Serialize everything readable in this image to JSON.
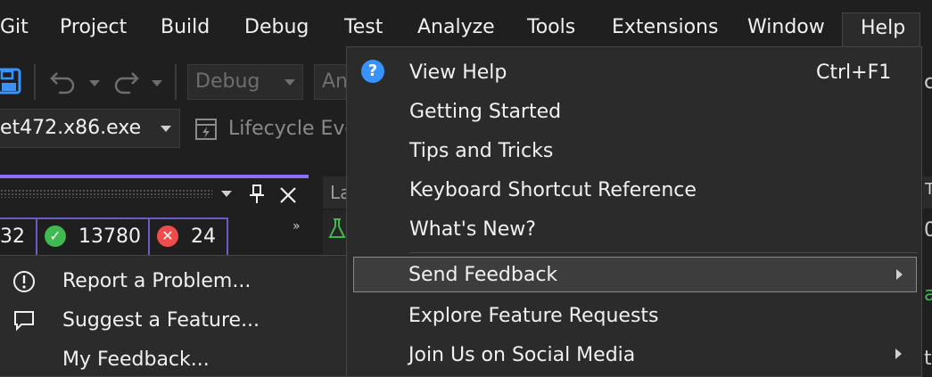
{
  "menubar": {
    "items": [
      "Git",
      "Project",
      "Build",
      "Debug",
      "Test",
      "Analyze",
      "Tools",
      "Extensions",
      "Window",
      "Help"
    ]
  },
  "toolbar": {
    "config_value": "Debug",
    "platform_value": "An",
    "startup_item": "et472.x86.exe",
    "lifecycle_label": "Lifecycle Eve"
  },
  "test_panel": {
    "count_total": "32",
    "count_passed": "13780",
    "count_failed": "24"
  },
  "doc_tab": {
    "label": "La"
  },
  "help_menu": {
    "items": [
      {
        "label": "View Help",
        "shortcut": "Ctrl+F1",
        "icon": "help-circle-icon"
      },
      {
        "label": "Getting Started"
      },
      {
        "label": "Tips and Tricks"
      },
      {
        "label": "Keyboard Shortcut Reference"
      },
      {
        "label": "What's New?"
      },
      {
        "label": "Send Feedback",
        "submenu": true,
        "highlighted": true
      },
      {
        "label": "Explore Feature Requests"
      },
      {
        "label": "Join Us on Social Media",
        "submenu": true
      }
    ]
  },
  "feedback_submenu": {
    "items": [
      {
        "label": "Report a Problem...",
        "icon": "exclamation-circle-icon"
      },
      {
        "label": "Suggest a Feature...",
        "icon": "speech-bubble-icon"
      },
      {
        "label": "My Feedback..."
      }
    ]
  },
  "edge_fragments": {
    "top": "c",
    "tab": "T",
    "mid1": "0",
    "mid2": "a",
    "bottom": "t"
  },
  "colors": {
    "accent": "#8f6eff",
    "help_icon": "#3794ff",
    "pass": "#3fb950",
    "fail": "#f14c4c"
  }
}
